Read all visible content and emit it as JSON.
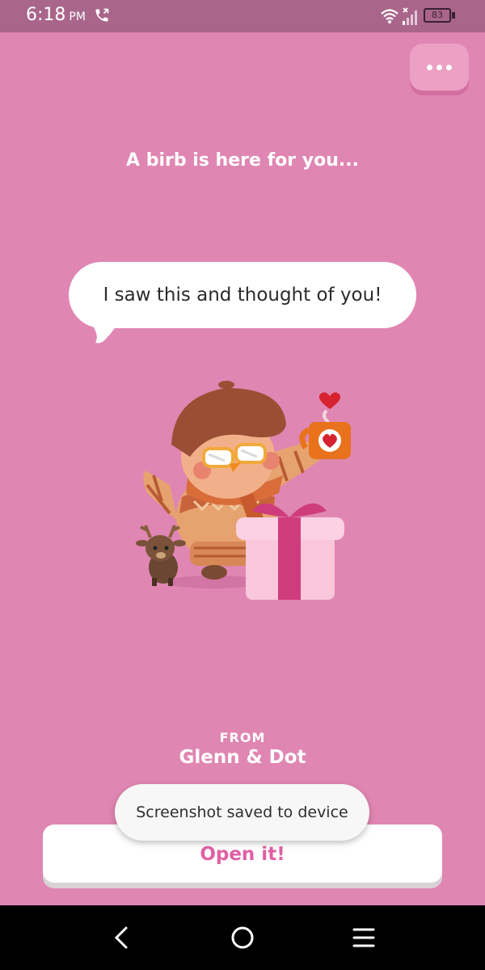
{
  "status_bar": {
    "time": "6:18",
    "ampm": "PM",
    "battery": "83",
    "icons": [
      "call-icon",
      "wifi-icon",
      "signal-icon",
      "battery-icon"
    ]
  },
  "menu_button_icon": "more-dots-icon",
  "headline": "A birb is here for you...",
  "bubble_text": "I saw this and thought of you!",
  "illustration": "bird-in-sweater-with-reindeer-and-gift",
  "from": {
    "label": "FROM",
    "name": "Glenn & Dot"
  },
  "open_button_label": "Open it!",
  "toast_text": "Screenshot saved to device",
  "nav_bar": [
    "back-icon",
    "home-icon",
    "recents-icon"
  ],
  "colors": {
    "background": "#e086b2",
    "status_bar": "#a9668a",
    "accent": "#e05fa3",
    "button_bg": "#ffffff"
  }
}
